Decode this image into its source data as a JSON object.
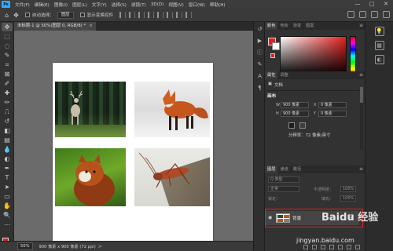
{
  "app": {
    "logo": "Ps",
    "window_controls": [
      "—",
      "□",
      "✕"
    ]
  },
  "menubar": {
    "items": [
      "文件(F)",
      "编辑(E)",
      "图像(I)",
      "图层(L)",
      "文字(Y)",
      "选择(S)",
      "滤镜(T)",
      "3D(D)",
      "视图(V)",
      "窗口(W)",
      "帮助(H)"
    ]
  },
  "optionsbar": {
    "auto_select_label": "自动选择：",
    "auto_select_value": "图层",
    "show_transform_label": "显示变换控件"
  },
  "document": {
    "tab_title": "未标题-1 @ 50%(图层 0, RGB/8) *",
    "tab_close": "×"
  },
  "statusbar": {
    "zoom": "50%",
    "info": "900 像素 x 900 像素 (72 ppi)",
    "arrow": ">"
  },
  "color_panel": {
    "tabs": [
      "颜色",
      "色板",
      "渐变",
      "图案"
    ],
    "active_tab": 0,
    "fg_color": "#e4201e",
    "bg_color": "#ffffff"
  },
  "properties_panel": {
    "tabs": [
      "属性",
      "调整"
    ],
    "active_tab": 0,
    "doc_label": "文档",
    "canvas_section": "画布",
    "w_label": "W",
    "h_label": "H",
    "x_label": "X",
    "y_label": "Y",
    "width": "900 像素",
    "height": "900 像素",
    "x_value": "0 像素",
    "y_value": "0 像素",
    "resolution": "分辨率：72 像素/英寸"
  },
  "layers_panel": {
    "tabs": [
      "图层",
      "通道",
      "路径"
    ],
    "active_tab": 0,
    "kind_label": "正常",
    "opacity_label": "不透明度：",
    "opacity_value": "100%",
    "lock_label": "锁定：",
    "fill_label": "填充：",
    "fill_value": "100%",
    "layer_name": "背景",
    "eye_glyph": "👁",
    "lock_glyph": "🔒"
  },
  "watermark": {
    "logo": "Baidu 经验",
    "url": "jingyan.baidu.com"
  },
  "icons": {
    "move": "✥",
    "marquee": "⬚",
    "lasso": "◌",
    "quick_select": "✎",
    "crop": "⌗",
    "frame": "⊠",
    "eyedropper": "✐",
    "heal": "✚",
    "brush": "✏",
    "stamp": "⎍",
    "history": "↺",
    "eraser": "◧",
    "gradient": "▤",
    "blur": "💧",
    "dodge": "◐",
    "pen": "✒",
    "type": "T",
    "path_select": "➤",
    "shape": "▭",
    "hand": "✋",
    "zoom": "🔍",
    "dots": "⋯"
  }
}
